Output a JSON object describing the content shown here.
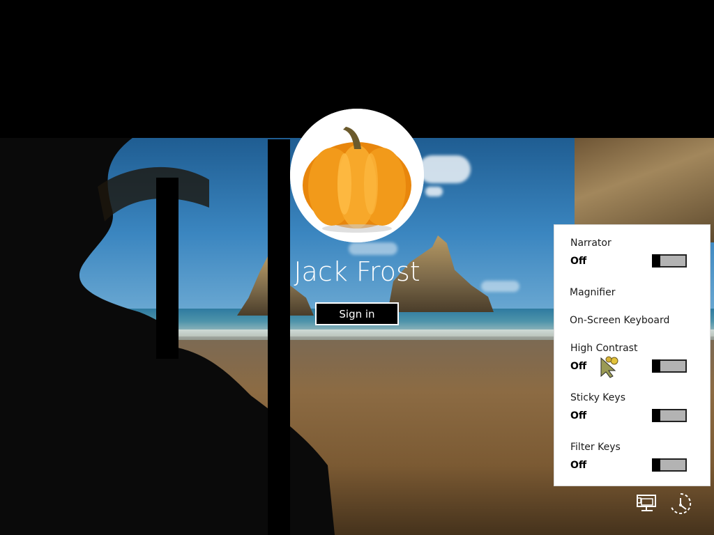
{
  "user": {
    "name": "Jack Frost",
    "avatar_icon": "pumpkin-avatar"
  },
  "signin_label": "Sign in",
  "ease_of_access": {
    "options": [
      {
        "name": "Narrator",
        "state": "Off",
        "toggle": true
      },
      {
        "name": "Magnifier",
        "toggle": false
      },
      {
        "name": "On-Screen Keyboard",
        "toggle": false
      },
      {
        "name": "High Contrast",
        "state": "Off",
        "toggle": true
      },
      {
        "name": "Sticky Keys",
        "state": "Off",
        "toggle": true
      },
      {
        "name": "Filter Keys",
        "state": "Off",
        "toggle": true
      }
    ]
  },
  "system_icons": [
    "network-icon",
    "ease-of-access-icon"
  ],
  "colors": {
    "flyout_bg": "#ffffff",
    "toggle_off": "#b3b3b3",
    "signin_border": "#ffffff"
  }
}
